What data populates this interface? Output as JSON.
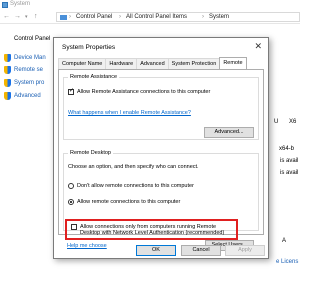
{
  "background_window": {
    "title": "System",
    "breadcrumb": [
      "Control Panel",
      "All Control Panel Items",
      "System"
    ],
    "left_pane": {
      "home_link": "Control Panel",
      "links": [
        "Device Man",
        "Remote se",
        "System pro",
        "Advanced"
      ]
    },
    "right_fragments": {
      "frag1": "U",
      "frag2": "X6",
      "frag3": "x64-b",
      "frag4": "is avail",
      "frag5": "is avail",
      "frag6": "A",
      "frag7": "e Licens"
    }
  },
  "dialog": {
    "title": "System Properties",
    "close_glyph": "✕",
    "tabs": [
      "Computer Name",
      "Hardware",
      "Advanced",
      "System Protection",
      "Remote"
    ],
    "active_tab": "Remote",
    "remote_assistance": {
      "group_title": "Remote Assistance",
      "allow_label": "Allow Remote Assistance connections to this computer",
      "allow_checked": true,
      "help_link": "What happens when I enable Remote Assistance?",
      "advanced_button": "Advanced..."
    },
    "remote_desktop": {
      "group_title": "Remote Desktop",
      "instruction": "Choose an option, and then specify who can connect.",
      "option_dont_allow": "Don't allow remote connections to this computer",
      "option_allow": "Allow remote connections to this computer",
      "selected_option": "allow",
      "nla_line1": "Allow connections only from computers running Remote",
      "nla_line2": "Desktop with Network Level Authentication (recommended)",
      "nla_checked": false,
      "help_link": "Help me choose",
      "select_users_button": "Select Users..."
    },
    "buttons": {
      "ok": "OK",
      "cancel": "Cancel",
      "apply": "Apply"
    }
  },
  "colors": {
    "accent_blue": "#0078d7",
    "highlight_red": "#e02020",
    "link_blue": "#0066cc"
  }
}
